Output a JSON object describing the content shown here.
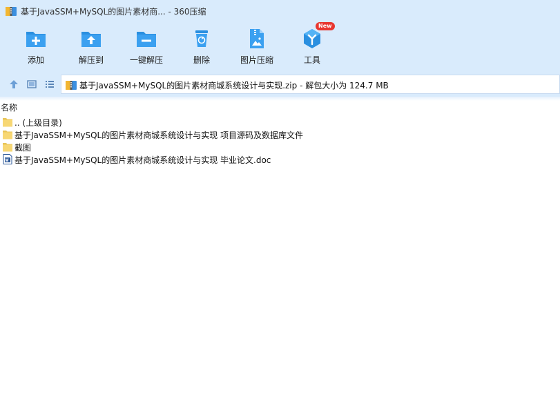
{
  "window": {
    "title": "基于JavaSSM+MySQL的图片素材商... - 360压缩"
  },
  "toolbar": {
    "items": [
      {
        "label": "添加",
        "icon": "add-folder-icon"
      },
      {
        "label": "解压到",
        "icon": "extract-to-icon"
      },
      {
        "label": "一键解压",
        "icon": "one-click-extract-icon"
      },
      {
        "label": "删除",
        "icon": "trash-icon"
      },
      {
        "label": "图片压缩",
        "icon": "image-compress-icon"
      },
      {
        "label": "工具",
        "icon": "tools-icon",
        "badge": "New"
      }
    ]
  },
  "address": {
    "path": "基于JavaSSM+MySQL的图片素材商城系统设计与实现.zip - 解包大小为 124.7 MB"
  },
  "list": {
    "column_name": "名称",
    "files": [
      {
        "name": ".. (上级目录)",
        "type": "folder"
      },
      {
        "name": "基于JavaSSM+MySQL的图片素材商城系统设计与实现 项目源码及数据库文件",
        "type": "folder"
      },
      {
        "name": "截图",
        "type": "folder"
      },
      {
        "name": "基于JavaSSM+MySQL的图片素材商城系统设计与实现 毕业论文.doc",
        "type": "doc"
      }
    ]
  },
  "colors": {
    "chrome_bg": "#d9ebfc",
    "icon_blue": "#2a8fe0",
    "folder_yellow": "#f7d774",
    "badge_red": "#e8362f"
  }
}
